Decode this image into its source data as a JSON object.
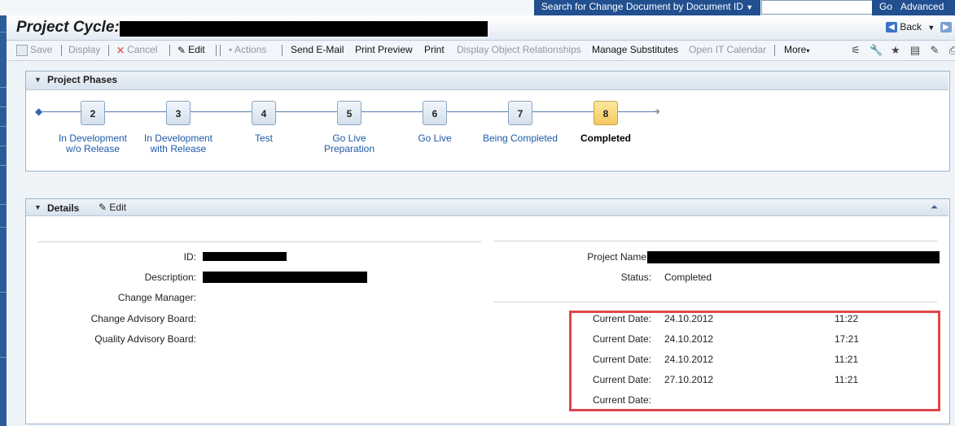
{
  "topbar": {
    "search_label": "Search for Change Document by Document ID",
    "search_value": "",
    "go": "Go",
    "advanced": "Advanced"
  },
  "title": {
    "label": "Project Cycle:",
    "back": "Back"
  },
  "toolbar": {
    "save": "Save",
    "display": "Display",
    "cancel": "Cancel",
    "edit": "Edit",
    "actions": "Actions",
    "send_email": "Send E-Mail",
    "print_preview": "Print Preview",
    "print": "Print",
    "display_rel": "Display Object Relationships",
    "manage_subs": "Manage Substitutes",
    "open_calendar": "Open IT Calendar",
    "more": "More"
  },
  "phases": {
    "title": "Project Phases",
    "current_index": 6,
    "steps": [
      {
        "number": "2",
        "label1": "In Development",
        "label2": "w/o Release"
      },
      {
        "number": "3",
        "label1": "In Development",
        "label2": "with Release"
      },
      {
        "number": "4",
        "label1": "Test",
        "label2": ""
      },
      {
        "number": "5",
        "label1": "Go Live",
        "label2": "Preparation"
      },
      {
        "number": "6",
        "label1": "Go Live",
        "label2": ""
      },
      {
        "number": "7",
        "label1": "Being Completed",
        "label2": ""
      },
      {
        "number": "8",
        "label1": "Completed",
        "label2": ""
      }
    ]
  },
  "details": {
    "title": "Details",
    "edit": "Edit",
    "left": [
      {
        "label": "ID:"
      },
      {
        "label": "Description:"
      },
      {
        "label": "Change Manager:"
      },
      {
        "label": "Change Advisory Board:"
      },
      {
        "label": "Quality Advisory Board:"
      }
    ],
    "project_name_label": "Project Name",
    "status_label": "Status:",
    "status_value": "Completed",
    "dates": [
      {
        "label": "Current Date:",
        "date": "24.10.2012",
        "time": "11:22"
      },
      {
        "label": "Current Date:",
        "date": "24.10.2012",
        "time": "17:21"
      },
      {
        "label": "Current Date:",
        "date": "24.10.2012",
        "time": "11:21"
      },
      {
        "label": "Current Date:",
        "date": "27.10.2012",
        "time": "11:21"
      },
      {
        "label": "Current Date:",
        "date": "",
        "time": ""
      }
    ]
  },
  "colors": {
    "accent": "#214f8f",
    "highlight": "#e0464b",
    "current_step": "#f4c860"
  }
}
